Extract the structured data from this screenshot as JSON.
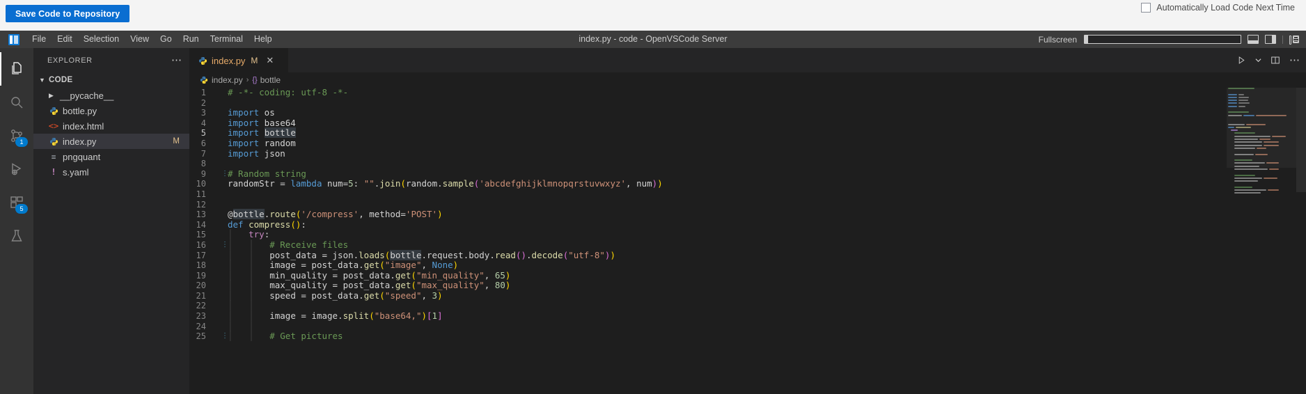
{
  "host": {
    "save_button": "Save Code to Repository",
    "autoload_label": "Automatically Load Code Next Time",
    "accent_color": "#0a6ed1"
  },
  "titlebar": {
    "logo_icon": "vscode-logo-icon",
    "menu": [
      "File",
      "Edit",
      "Selection",
      "View",
      "Go",
      "Run",
      "Terminal",
      "Help"
    ],
    "window_title": "index.py - code - OpenVSCode Server",
    "fullscreen_label": "Fullscreen",
    "layout_icons": [
      "toggle-primary-sidebar-icon",
      "toggle-panel-icon",
      "toggle-secondary-sidebar-icon",
      "customize-layout-icon"
    ]
  },
  "activitybar": {
    "items": [
      {
        "name": "explorer",
        "icon": "files-icon",
        "active": true,
        "badge": ""
      },
      {
        "name": "search",
        "icon": "search-icon",
        "active": false,
        "badge": ""
      },
      {
        "name": "source-control",
        "icon": "source-control-icon",
        "active": false,
        "badge": "1"
      },
      {
        "name": "run-and-debug",
        "icon": "run-debug-icon",
        "active": false,
        "badge": ""
      },
      {
        "name": "extensions",
        "icon": "extensions-icon",
        "active": false,
        "badge": "5"
      },
      {
        "name": "testing",
        "icon": "beaker-icon",
        "active": false,
        "badge": ""
      }
    ]
  },
  "sidebar": {
    "title": "EXPLORER",
    "more_actions_icon": "ellipsis-icon",
    "root": {
      "label": "CODE",
      "expanded": true
    },
    "files": [
      {
        "label": "__pycache__",
        "icon": "folder-icon",
        "kind": "folder",
        "expanded": false,
        "selected": false,
        "status": ""
      },
      {
        "label": "bottle.py",
        "icon": "python-file-icon",
        "kind": "file",
        "selected": false,
        "status": ""
      },
      {
        "label": "index.html",
        "icon": "html-file-icon",
        "kind": "file",
        "selected": false,
        "status": ""
      },
      {
        "label": "index.py",
        "icon": "python-file-icon",
        "kind": "file",
        "selected": true,
        "status": "M"
      },
      {
        "label": "pngquant",
        "icon": "binary-file-icon",
        "kind": "file",
        "selected": false,
        "status": ""
      },
      {
        "label": "s.yaml",
        "icon": "yaml-file-icon",
        "kind": "file",
        "selected": false,
        "status": ""
      }
    ]
  },
  "editor": {
    "tab": {
      "label": "index.py",
      "icon": "python-file-icon",
      "modified_marker": "M",
      "close_icon": "close-icon"
    },
    "tab_actions": [
      "run-python-file-icon",
      "chevron-down-icon",
      "split-editor-down-icon",
      "split-editor-right-icon",
      "more-actions-icon"
    ],
    "breadcrumb": {
      "file": "index.py",
      "separator": "›",
      "symbol_prefix": "{}",
      "symbol": "bottle"
    },
    "code": {
      "language": "python",
      "current_line": 5,
      "highlight_word": "bottle",
      "lines": [
        {
          "n": 1,
          "text": "# -*- coding: utf-8 -*-"
        },
        {
          "n": 2,
          "text": ""
        },
        {
          "n": 3,
          "text": "import os"
        },
        {
          "n": 4,
          "text": "import base64"
        },
        {
          "n": 5,
          "text": "import bottle"
        },
        {
          "n": 6,
          "text": "import random"
        },
        {
          "n": 7,
          "text": "import json"
        },
        {
          "n": 8,
          "text": ""
        },
        {
          "n": 9,
          "text": "# Random string"
        },
        {
          "n": 10,
          "text": "randomStr = lambda num=5: \"\".join(random.sample('abcdefghijklmnopqrstuvwxyz', num))"
        },
        {
          "n": 11,
          "text": ""
        },
        {
          "n": 12,
          "text": ""
        },
        {
          "n": 13,
          "text": "@bottle.route('/compress', method='POST')"
        },
        {
          "n": 14,
          "text": "def compress():"
        },
        {
          "n": 15,
          "text": "    try:"
        },
        {
          "n": 16,
          "text": "        # Receive files"
        },
        {
          "n": 17,
          "text": "        post_data = json.loads(bottle.request.body.read().decode(\"utf-8\"))"
        },
        {
          "n": 18,
          "text": "        image = post_data.get(\"image\", None)"
        },
        {
          "n": 19,
          "text": "        min_quality = post_data.get(\"min_quality\", 65)"
        },
        {
          "n": 20,
          "text": "        max_quality = post_data.get(\"max_quality\", 80)"
        },
        {
          "n": 21,
          "text": "        speed = post_data.get(\"speed\", 3)"
        },
        {
          "n": 22,
          "text": ""
        },
        {
          "n": 23,
          "text": "        image = image.split(\"base64,\")[1]"
        },
        {
          "n": 24,
          "text": ""
        },
        {
          "n": 25,
          "text": "        # Get pictures"
        }
      ]
    }
  }
}
